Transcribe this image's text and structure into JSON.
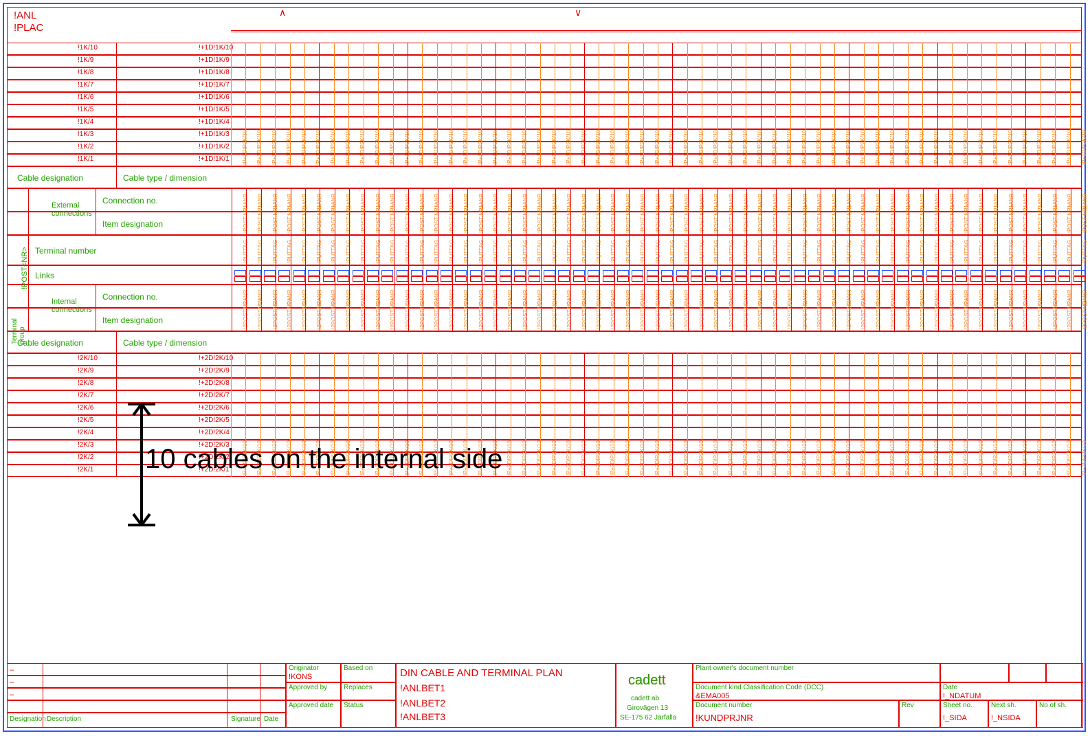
{
  "header": {
    "line1": "!ANL",
    "line2": "!PLAC"
  },
  "carets": {
    "left": "∧",
    "right": "∨"
  },
  "upper_cables": [
    {
      "c1": "!1K/10",
      "c2": "!+1D!1K/10"
    },
    {
      "c1": "!1K/9",
      "c2": "!+1D!1K/9"
    },
    {
      "c1": "!1K/8",
      "c2": "!+1D!1K/8"
    },
    {
      "c1": "!1K/7",
      "c2": "!+1D!1K/7"
    },
    {
      "c1": "!1K/6",
      "c2": "!+1D!1K/6"
    },
    {
      "c1": "!1K/5",
      "c2": "!+1D!1K/5"
    },
    {
      "c1": "!1K/4",
      "c2": "!+1D!1K/4"
    },
    {
      "c1": "!1K/3",
      "c2": "!+1D!1K/3"
    },
    {
      "c1": "!1K/2",
      "c2": "!+1D!1K/2"
    },
    {
      "c1": "!1K/1",
      "c2": "!+1D!1K/1"
    }
  ],
  "lower_cables": [
    {
      "c1": "!2K/10",
      "c2": "!+2D!2K/10"
    },
    {
      "c1": "!2K/9",
      "c2": "!+2D!2K/9"
    },
    {
      "c1": "!2K/8",
      "c2": "!+2D!2K/8"
    },
    {
      "c1": "!2K/7",
      "c2": "!+2D!2K/7"
    },
    {
      "c1": "!2K/6",
      "c2": "!+2D!2K/6"
    },
    {
      "c1": "!2K/5",
      "c2": "!+2D!2K/5"
    },
    {
      "c1": "!2K/4",
      "c2": "!+2D!2K/4"
    },
    {
      "c1": "!2K/3",
      "c2": "!+2D!2K/3"
    },
    {
      "c1": "!2K/2",
      "c2": "!+2D!2K/2"
    },
    {
      "c1": "!2K/1",
      "c2": "!+2D!2K/1"
    }
  ],
  "mid_labels": {
    "cable_desig": "Cable designation",
    "cable_type": "Cable type / dimension",
    "ext_conn": "External\nconnections",
    "int_conn": "Internal\nconnections",
    "conn_no": "Connection no.",
    "item_desig": "Item designation",
    "term_no": "Terminal number",
    "links": "Links",
    "term_group": "Terminal\ngroup",
    "post_nr": "!POST<NR>"
  },
  "col_text": {
    "upper_cell": "!P+1D!P2K/10",
    "ext_1": "!1ANR",
    "ext_2": "!POST.NR+",
    "term": "!PUTTAG",
    "int_1": "!2ANR",
    "int_2": "!2POST.NR+",
    "lower_cell": "!P+2D!P2K/10"
  },
  "n_columns": 58,
  "group_size": 6,
  "annotation": "10 cables on the internal side",
  "title": {
    "main": "DIN CABLE AND TERMINAL PLAN",
    "l1": "!ANLBET1",
    "l2": "!ANLBET2",
    "l3": "!ANLBET3",
    "company": "cadett",
    "company_sub": "cadett ab",
    "addr1": "Girovägen 13",
    "addr2": "SE-175 62 Järfälla",
    "orig_lab": "Originator",
    "orig": "!KONS",
    "based_lab": "Based on",
    "appr_lab": "Approved by",
    "repl_lab": "Replaces",
    "apprdate_lab": "Approved date",
    "status_lab": "Status",
    "desig_lab": "Designation",
    "desc_lab": "Description",
    "sign_lab": "Signature",
    "date_lab": "Date",
    "own_lab": "Plant owner's document number",
    "dcc_lab": "Document kind Classification Code (DCC)",
    "dcc": "&EMA005",
    "date2_lab": "Date",
    "date2": "!_NDATUM",
    "docnum_lab": "Document number",
    "docnum": "!KUNDPRJNR",
    "rev_lab": "Rev",
    "sheet_lab": "Sheet no.",
    "sheet": "!_SIDA",
    "next_lab": "Next sh.",
    "next": "!_NSIDA",
    "nsh_lab": "No of sh."
  }
}
